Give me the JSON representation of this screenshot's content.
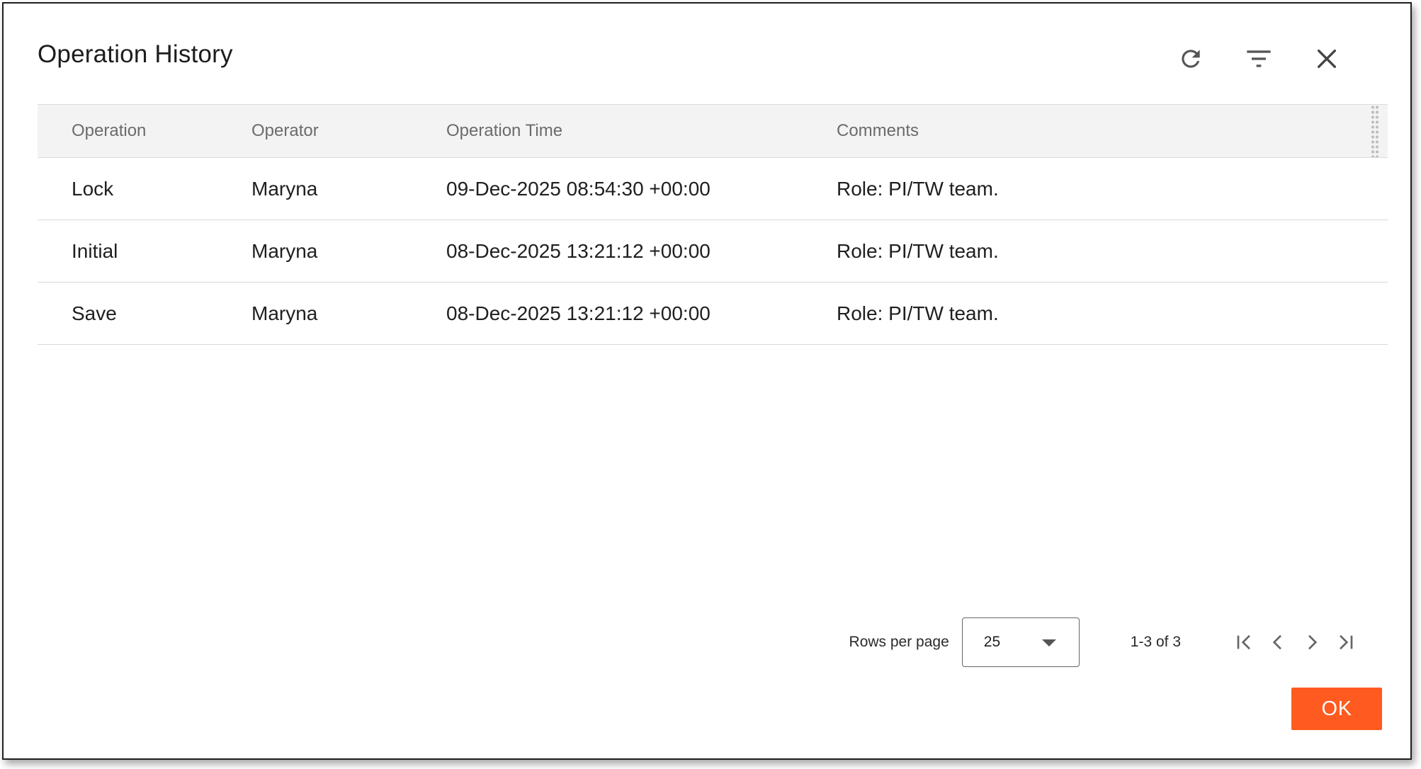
{
  "dialog": {
    "title": "Operation History"
  },
  "header_icons": [
    "refresh-icon",
    "filter-icon",
    "close-icon"
  ],
  "table": {
    "columns": [
      "Operation",
      "Operator",
      "Operation Time",
      "Comments"
    ],
    "rows": [
      {
        "operation": "Lock",
        "operator": "Maryna",
        "time": "09-Dec-2025 08:54:30 +00:00",
        "comments": "Role: PI/TW team."
      },
      {
        "operation": "Initial",
        "operator": "Maryna",
        "time": "08-Dec-2025 13:21:12 +00:00",
        "comments": "Role: PI/TW team."
      },
      {
        "operation": "Save",
        "operator": "Maryna",
        "time": "08-Dec-2025 13:21:12 +00:00",
        "comments": "Role: PI/TW team."
      }
    ]
  },
  "pagination": {
    "rows_per_page_label": "Rows per page",
    "rows_per_page_value": "25",
    "range": "1-3 of 3",
    "nav_icons": [
      "first-page-icon",
      "prev-page-icon",
      "next-page-icon",
      "last-page-icon"
    ]
  },
  "footer": {
    "ok_label": "OK"
  },
  "colors": {
    "accent": "#ff5a1f",
    "header_bg": "#f3f3f3",
    "text": "#1f1f1f"
  }
}
